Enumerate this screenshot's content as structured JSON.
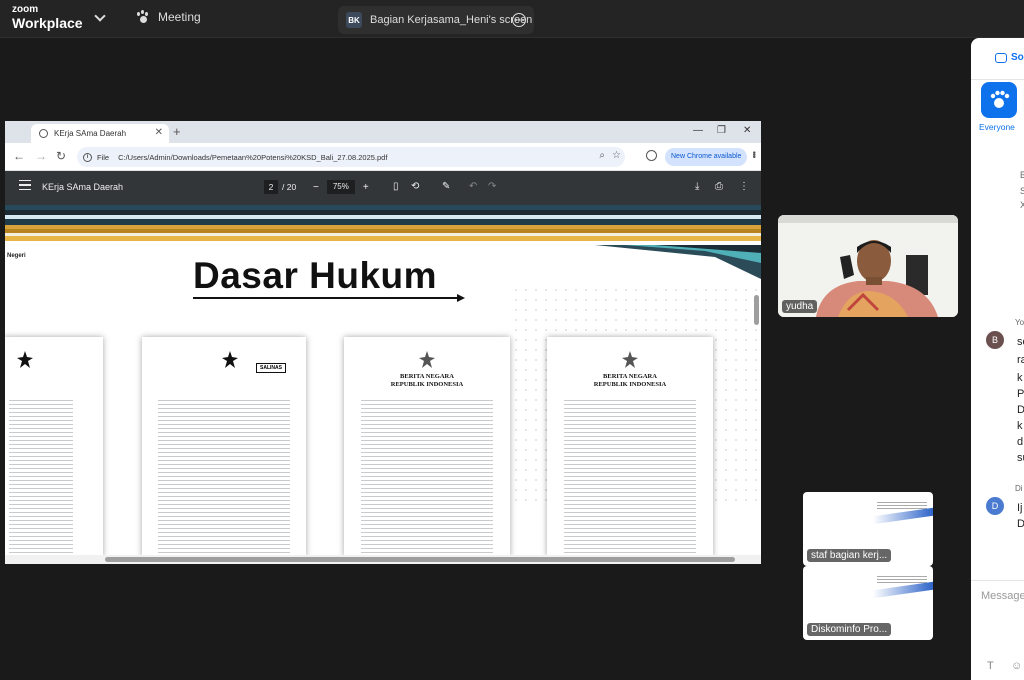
{
  "zoom": {
    "brand_small": "zoom",
    "brand_large": "Workplace",
    "meeting_tab": "Meeting",
    "share": {
      "initials": "BK",
      "title": "Bagian Kerjasama_Heni's screen"
    }
  },
  "browser": {
    "tab_title": "KErja SAma Daerah",
    "file_label": "File",
    "url": "C:/Users/Admin/Downloads/Pemetaan%20Potensi%20KSD_Bali_27.08.2025.pdf",
    "new_chrome_label": "New Chrome available"
  },
  "pdf": {
    "title": "KErja SAma Daerah",
    "page_current": "2",
    "page_total": "/ 20",
    "zoom": "75%",
    "slide": {
      "corner_text": "Negeri",
      "heading": "Dasar Hukum",
      "docs": [
        {
          "line1": "",
          "line2": ""
        },
        {
          "line1": "",
          "line2": "",
          "badge": "SALINAS"
        },
        {
          "line1": "BERITA NEGARA",
          "line2": "REPUBLIK INDONESIA"
        },
        {
          "line1": "BERITA NEGARA",
          "line2": "REPUBLIK INDONESIA"
        }
      ]
    }
  },
  "participants": {
    "yudha": "yudha",
    "staf": "staf bagian kerj...",
    "diskominfo": "Diskominfo Pro..."
  },
  "chat": {
    "header": "So",
    "everyone_label": "Everyone",
    "snippets": [
      "B",
      "S",
      "X"
    ],
    "sender_label_1": "Yo",
    "avatar_1": "B",
    "message_1_lines": [
      "se",
      "ra",
      "k",
      "P",
      "D",
      "k",
      "d",
      "su"
    ],
    "sender_label_2": "Di",
    "avatar_2": "D",
    "message_2_lines": [
      "Ij",
      "D"
    ],
    "input_placeholder": "Message"
  },
  "colors": {
    "zoom_blue": "#0e72ed",
    "pdf_toolbar": "#323639",
    "gold_stripe": "#d8a23a",
    "teal_stripe": "#274a5a"
  }
}
